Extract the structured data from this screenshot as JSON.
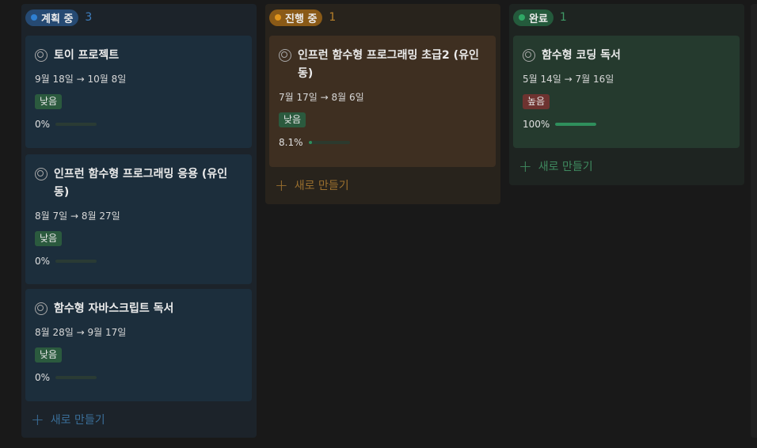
{
  "columns": [
    {
      "status": "계획 중",
      "count": "3",
      "dot_color": "#2f80d1",
      "pill_color": "#264a73",
      "count_color": "#3f7fc0",
      "new_label": "새로 만들기",
      "cards": [
        {
          "title": "토이 프로젝트",
          "date": "9월 18일 → 10월 8일",
          "priority": "낮음",
          "progress": "0%"
        },
        {
          "title": "인프런 함수형 프로그래밍 응용 (유인동)",
          "date": "8월 7일 → 8월 27일",
          "priority": "낮음",
          "progress": "0%"
        },
        {
          "title": "함수형 자바스크립트 독서",
          "date": "8월 28일 → 9월 17일",
          "priority": "낮음",
          "progress": "0%"
        }
      ]
    },
    {
      "status": "진행 중",
      "count": "1",
      "dot_color": "#e0951c",
      "pill_color": "#8a5a17",
      "count_color": "#b8802a",
      "new_label": "새로 만들기",
      "cards": [
        {
          "title": "인프런 함수형 프로그래밍 초급2 (유인동)",
          "date": "7월 17일 → 8월 6일",
          "priority": "낮음",
          "progress": "8.1%"
        }
      ]
    },
    {
      "status": "완료",
      "count": "1",
      "dot_color": "#2fa865",
      "pill_color": "#245a3c",
      "count_color": "#3f9a66",
      "new_label": "새로 만들기",
      "cards": [
        {
          "title": "함수형 코딩 독서",
          "date": "5월 14일 → 7월 16일",
          "priority": "높음",
          "progress": "100%"
        }
      ]
    }
  ]
}
